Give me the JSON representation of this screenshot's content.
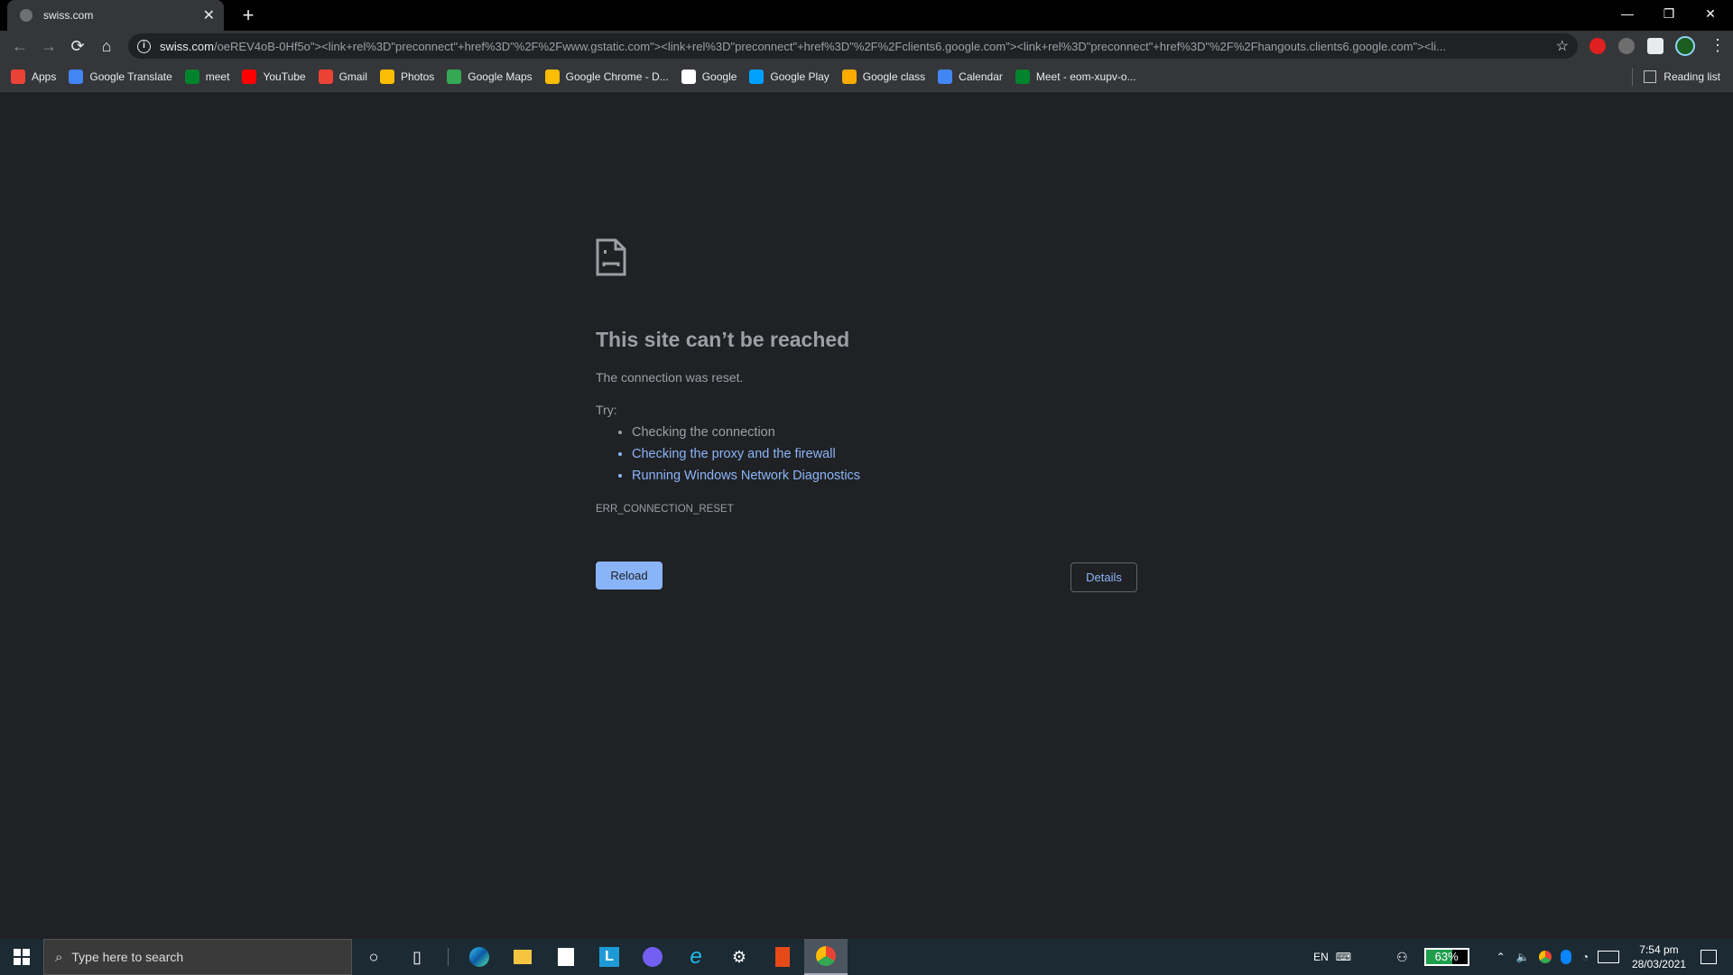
{
  "tab": {
    "title": "swiss.com",
    "close": "✕",
    "new_tab": "+"
  },
  "window": {
    "minimize": "—",
    "restore": "❐",
    "close": "✕"
  },
  "toolbar": {
    "back": "←",
    "forward": "→",
    "reload": "⟳",
    "home": "⌂",
    "url_host": "swiss.com",
    "url_path": "/oeREV4oB-0Hf5o\"><link+rel%3D\"preconnect\"+href%3D\"%2F%2Fwww.gstatic.com\"><link+rel%3D\"preconnect\"+href%3D\"%2F%2Fclients6.google.com\"><link+rel%3D\"preconnect\"+href%3D\"%2F%2Fhangouts.clients6.google.com\"><li...",
    "bookmark_star": "☆",
    "extensions": [
      "stop-extension",
      "media-extension",
      "extensions-puzzle",
      "profile-avatar"
    ],
    "menu": "⋮"
  },
  "bookmarks": [
    {
      "label": "Apps",
      "icon": "apps-grid-icon",
      "color": "#ea4335"
    },
    {
      "label": "Google Translate",
      "icon": "google-translate-icon",
      "color": "#4285f4"
    },
    {
      "label": "meet",
      "icon": "google-meet-icon",
      "color": "#00832d"
    },
    {
      "label": "YouTube",
      "icon": "youtube-icon",
      "color": "#ff0000"
    },
    {
      "label": "Gmail",
      "icon": "gmail-icon",
      "color": "#ea4335"
    },
    {
      "label": "Photos",
      "icon": "google-photos-icon",
      "color": "#fbbc04"
    },
    {
      "label": "Google Maps",
      "icon": "google-maps-icon",
      "color": "#34a853"
    },
    {
      "label": "Google Chrome - D...",
      "icon": "chrome-icon",
      "color": "#fbbc04"
    },
    {
      "label": "Google",
      "icon": "google-icon",
      "color": "#ffffff"
    },
    {
      "label": "Google Play",
      "icon": "google-play-icon",
      "color": "#00a0ff"
    },
    {
      "label": "Google class",
      "icon": "google-classroom-icon",
      "color": "#f9ab00"
    },
    {
      "label": "Calendar",
      "icon": "google-calendar-icon",
      "color": "#4285f4"
    },
    {
      "label": "Meet - eom-xupv-o...",
      "icon": "google-meet-icon",
      "color": "#00832d"
    }
  ],
  "reading_list": "Reading list",
  "error": {
    "title": "This site can’t be reached",
    "description": "The connection was reset.",
    "try_label": "Try:",
    "suggestions": [
      {
        "text": "Checking the connection",
        "link": false
      },
      {
        "text": "Checking the proxy and the firewall",
        "link": true
      },
      {
        "text": "Running Windows Network Diagnostics",
        "link": true
      }
    ],
    "code": "ERR_CONNECTION_RESET",
    "reload_button": "Reload",
    "details_button": "Details"
  },
  "taskbar": {
    "search_placeholder": "Type here to search",
    "apps": [
      "cortana",
      "task-view",
      "edge",
      "file-explorer",
      "microsoft-store",
      "l-app",
      "viber",
      "internet-explorer",
      "settings",
      "office",
      "chrome"
    ],
    "language": "EN",
    "battery": "63%",
    "time": "7:54 pm",
    "date": "28/03/2021"
  },
  "colors": {
    "accent": "#8ab4f8",
    "page_bg": "#202124",
    "toolbar_bg": "#35363a"
  }
}
